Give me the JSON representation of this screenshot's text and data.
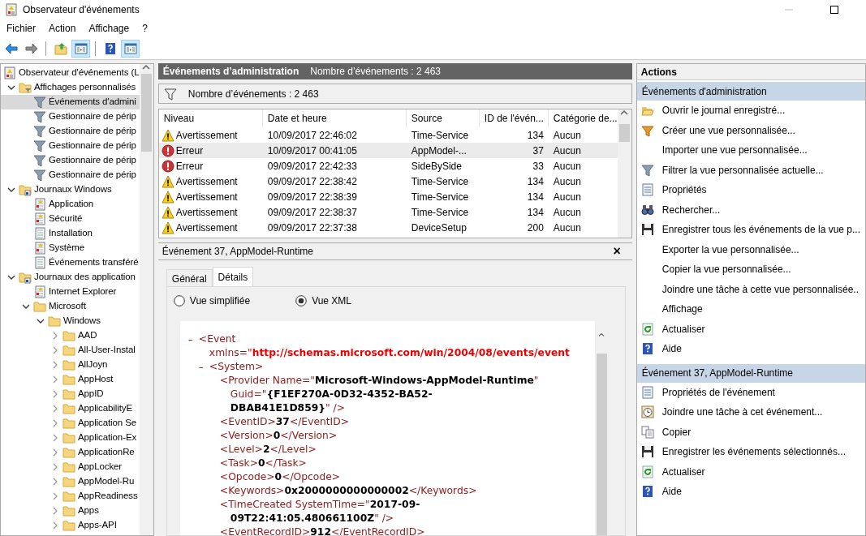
{
  "window": {
    "title": "Observateur d'événements"
  },
  "menu": [
    "Fichier",
    "Action",
    "Affichage",
    "?"
  ],
  "toolbar": [
    {
      "kind": "back",
      "pressed": false,
      "separator_before": false
    },
    {
      "kind": "forward",
      "pressed": false,
      "separator_before": false
    },
    {
      "kind": "up",
      "pressed": false,
      "separator_before": true
    },
    {
      "kind": "pane",
      "pressed": true,
      "separator_before": false
    },
    {
      "kind": "help",
      "pressed": false,
      "separator_before": true
    },
    {
      "kind": "pane",
      "pressed": true,
      "separator_before": false
    }
  ],
  "tree": [
    {
      "label": "Observateur d'événements (L",
      "kind": "viewer",
      "selected": false,
      "children": [
        {
          "label": "Affichages personnalisés",
          "kind": "folder-filter",
          "expanded": true,
          "selected": false,
          "children": [
            {
              "label": "Événements d'admini",
              "kind": "filter",
              "selected": true
            },
            {
              "label": "Gestionnaire de périp",
              "kind": "filter",
              "selected": false
            },
            {
              "label": "Gestionnaire de périp",
              "kind": "filter",
              "selected": false
            },
            {
              "label": "Gestionnaire de périp",
              "kind": "filter",
              "selected": false
            },
            {
              "label": "Gestionnaire de périp",
              "kind": "filter",
              "selected": false
            },
            {
              "label": "Gestionnaire de périp",
              "kind": "filter",
              "selected": false
            }
          ]
        },
        {
          "label": "Journaux Windows",
          "kind": "folder-log",
          "expanded": true,
          "selected": false,
          "children": [
            {
              "label": "Application",
              "kind": "log",
              "selected": false
            },
            {
              "label": "Sécurité",
              "kind": "log",
              "selected": false
            },
            {
              "label": "Installation",
              "kind": "log-plain",
              "selected": false
            },
            {
              "label": "Système",
              "kind": "log",
              "selected": false
            },
            {
              "label": "Événements transféré",
              "kind": "log-plain",
              "selected": false
            }
          ]
        },
        {
          "label": "Journaux des application",
          "kind": "folder-log",
          "expanded": true,
          "selected": false,
          "children": [
            {
              "label": "Internet Explorer",
              "kind": "log",
              "selected": false
            },
            {
              "label": "Microsoft",
              "kind": "folder",
              "expanded": true,
              "selected": false,
              "children": [
                {
                  "label": "Windows",
                  "kind": "folder",
                  "expanded": true,
                  "selected": false,
                  "children": [
                    {
                      "label": "AAD",
                      "kind": "folder",
                      "expanded": false,
                      "selected": false
                    },
                    {
                      "label": "All-User-Instal",
                      "kind": "folder",
                      "expanded": false,
                      "selected": false
                    },
                    {
                      "label": "AllJoyn",
                      "kind": "folder",
                      "expanded": false,
                      "selected": false
                    },
                    {
                      "label": "AppHost",
                      "kind": "folder",
                      "expanded": false,
                      "selected": false
                    },
                    {
                      "label": "AppID",
                      "kind": "folder",
                      "expanded": false,
                      "selected": false
                    },
                    {
                      "label": "ApplicabilityE",
                      "kind": "folder",
                      "expanded": false,
                      "selected": false
                    },
                    {
                      "label": "Application Se",
                      "kind": "folder",
                      "expanded": false,
                      "selected": false
                    },
                    {
                      "label": "Application-Ex",
                      "kind": "folder",
                      "expanded": false,
                      "selected": false
                    },
                    {
                      "label": "ApplicationRe",
                      "kind": "folder",
                      "expanded": false,
                      "selected": false
                    },
                    {
                      "label": "AppLocker",
                      "kind": "folder",
                      "expanded": false,
                      "selected": false
                    },
                    {
                      "label": "AppModel-Ru",
                      "kind": "folder",
                      "expanded": false,
                      "selected": false
                    },
                    {
                      "label": "AppReadiness",
                      "kind": "folder",
                      "expanded": false,
                      "selected": false
                    },
                    {
                      "label": "Apps",
                      "kind": "folder",
                      "expanded": false,
                      "selected": false
                    },
                    {
                      "label": "Apps-API",
                      "kind": "folder",
                      "expanded": false,
                      "selected": false
                    }
                  ]
                }
              ]
            }
          ]
        }
      ]
    }
  ],
  "view": {
    "title": "Événements d’administration",
    "count": "Nombre d’événements : 2 463",
    "filter_text": "Nombre d’événements : 2 463"
  },
  "table": {
    "columns": [
      "Niveau",
      "Date et heure",
      "Source",
      "ID de l'évén...",
      "Catégorie de..."
    ],
    "rows": [
      {
        "kind": "warning",
        "cells": [
          "Avertissement",
          "10/09/2017 22:46:02",
          "Time-Service",
          "134",
          "Aucun"
        ],
        "selected": false
      },
      {
        "kind": "error",
        "cells": [
          "Erreur",
          "10/09/2017 00:41:05",
          "AppModel-...",
          "37",
          "Aucun"
        ],
        "selected": true
      },
      {
        "kind": "error",
        "cells": [
          "Erreur",
          "09/09/2017 22:42:33",
          "SideBySide",
          "33",
          "Aucun"
        ],
        "selected": false
      },
      {
        "kind": "warning",
        "cells": [
          "Avertissement",
          "09/09/2017 22:38:42",
          "Time-Service",
          "134",
          "Aucun"
        ],
        "selected": false
      },
      {
        "kind": "warning",
        "cells": [
          "Avertissement",
          "09/09/2017 22:38:39",
          "Time-Service",
          "134",
          "Aucun"
        ],
        "selected": false
      },
      {
        "kind": "warning",
        "cells": [
          "Avertissement",
          "09/09/2017 22:38:37",
          "Time-Service",
          "134",
          "Aucun"
        ],
        "selected": false
      },
      {
        "kind": "warning",
        "cells": [
          "Avertissement",
          "09/09/2017 22:37:38",
          "DeviceSetup",
          "200",
          "Aucun"
        ],
        "selected": false
      }
    ]
  },
  "detail": {
    "title": "Événement 37, AppModel-Runtime",
    "close": "×",
    "tabs": [
      {
        "label": "Général",
        "selected": false
      },
      {
        "label": "Détails",
        "selected": true
      }
    ],
    "radios": [
      {
        "label": "Vue simplifiée",
        "checked": false
      },
      {
        "label": "Vue XML",
        "checked": true
      }
    ],
    "xml": [
      {
        "toggle": "–",
        "lines": [
          [
            {
              "kind": "markup",
              "text": "<Event"
            }
          ],
          [
            {
              "kind": "markup",
              "text": "xmlns=\""
            },
            {
              "kind": "link",
              "text": "http://schemas.microsoft.com/win/2004/08/events/event"
            }
          ]
        ],
        "children": [
          {
            "toggle": "–",
            "lines": [
              [
                {
                  "kind": "markup",
                  "text": "<System>"
                }
              ]
            ],
            "children": [
              {
                "lines": [
                  [
                    {
                      "kind": "markup",
                      "text": "<Provider Name=\""
                    },
                    {
                      "kind": "value",
                      "text": "Microsoft-Windows-AppModel-Runtime"
                    },
                    {
                      "kind": "markup",
                      "text": "\""
                    }
                  ],
                  [
                    {
                      "kind": "markup",
                      "text": "Guid=\""
                    },
                    {
                      "kind": "value",
                      "text": "{F1EF270A-0D32-4352-BA52-"
                    }
                  ],
                  [
                    {
                      "kind": "value",
                      "text": "DBAB41E1D859}"
                    },
                    {
                      "kind": "markup",
                      "text": "\" />"
                    }
                  ]
                ]
              },
              {
                "lines": [
                  [
                    {
                      "kind": "markup",
                      "text": "<EventID>"
                    },
                    {
                      "kind": "value",
                      "text": "37"
                    },
                    {
                      "kind": "markup",
                      "text": "</EventID>"
                    }
                  ]
                ]
              },
              {
                "lines": [
                  [
                    {
                      "kind": "markup",
                      "text": "<Version>"
                    },
                    {
                      "kind": "value",
                      "text": "0"
                    },
                    {
                      "kind": "markup",
                      "text": "</Version>"
                    }
                  ]
                ]
              },
              {
                "lines": [
                  [
                    {
                      "kind": "markup",
                      "text": "<Level>"
                    },
                    {
                      "kind": "value",
                      "text": "2"
                    },
                    {
                      "kind": "markup",
                      "text": "</Level>"
                    }
                  ]
                ]
              },
              {
                "lines": [
                  [
                    {
                      "kind": "markup",
                      "text": "<Task>"
                    },
                    {
                      "kind": "value",
                      "text": "0"
                    },
                    {
                      "kind": "markup",
                      "text": "</Task>"
                    }
                  ]
                ]
              },
              {
                "lines": [
                  [
                    {
                      "kind": "markup",
                      "text": "<Opcode>"
                    },
                    {
                      "kind": "value",
                      "text": "0"
                    },
                    {
                      "kind": "markup",
                      "text": "</Opcode>"
                    }
                  ]
                ]
              },
              {
                "lines": [
                  [
                    {
                      "kind": "markup",
                      "text": "<Keywords>"
                    },
                    {
                      "kind": "value",
                      "text": "0x2000000000000002"
                    },
                    {
                      "kind": "markup",
                      "text": "</Keywords>"
                    }
                  ]
                ]
              },
              {
                "lines": [
                  [
                    {
                      "kind": "markup",
                      "text": "<TimeCreated SystemTime=\""
                    },
                    {
                      "kind": "value",
                      "text": "2017-09-"
                    }
                  ],
                  [
                    {
                      "kind": "value",
                      "text": "09T22:41:05.480661100Z"
                    },
                    {
                      "kind": "markup",
                      "text": "\" />"
                    }
                  ]
                ]
              },
              {
                "lines": [
                  [
                    {
                      "kind": "markup",
                      "text": "<EventRecordID>"
                    },
                    {
                      "kind": "value",
                      "text": "912"
                    },
                    {
                      "kind": "markup",
                      "text": "</EventRecordID>"
                    }
                  ]
                ]
              }
            ]
          }
        ]
      }
    ]
  },
  "actions": {
    "title": "Actions",
    "sections": [
      {
        "title": "Événements d'administration",
        "items": [
          {
            "label": "Ouvrir le journal enregistré...",
            "kind": "open"
          },
          {
            "label": "Créer une vue personnalisée...",
            "kind": "new-filter"
          },
          {
            "label": "Importer une vue personnalisée...",
            "kind": "none"
          },
          {
            "label": "Filtrer la vue personnalisée actuelle...",
            "kind": "filter"
          },
          {
            "label": "Propriétés",
            "kind": "properties"
          },
          {
            "label": "Rechercher...",
            "kind": "find"
          },
          {
            "label": "Enregistrer tous les événements de la vue p...",
            "kind": "save"
          },
          {
            "label": "Exporter la vue personnalisée...",
            "kind": "none"
          },
          {
            "label": "Copier la vue personnalisée...",
            "kind": "none"
          },
          {
            "label": "Joindre une tâche à cette vue personnalisée..",
            "kind": "none"
          },
          {
            "label": "Affichage",
            "kind": "none"
          },
          {
            "label": "Actualiser",
            "kind": "refresh"
          },
          {
            "label": "Aide",
            "kind": "help"
          }
        ]
      },
      {
        "title": "Événement 37, AppModel-Runtime",
        "items": [
          {
            "label": "Propriétés de l'événement",
            "kind": "properties"
          },
          {
            "label": "Joindre une tâche à cet événement...",
            "kind": "task"
          },
          {
            "label": "Copier",
            "kind": "copy"
          },
          {
            "label": "Enregistrer les événements sélectionnés...",
            "kind": "save"
          },
          {
            "label": "Actualiser",
            "kind": "refresh"
          },
          {
            "label": "Aide",
            "kind": "help"
          }
        ]
      }
    ]
  }
}
